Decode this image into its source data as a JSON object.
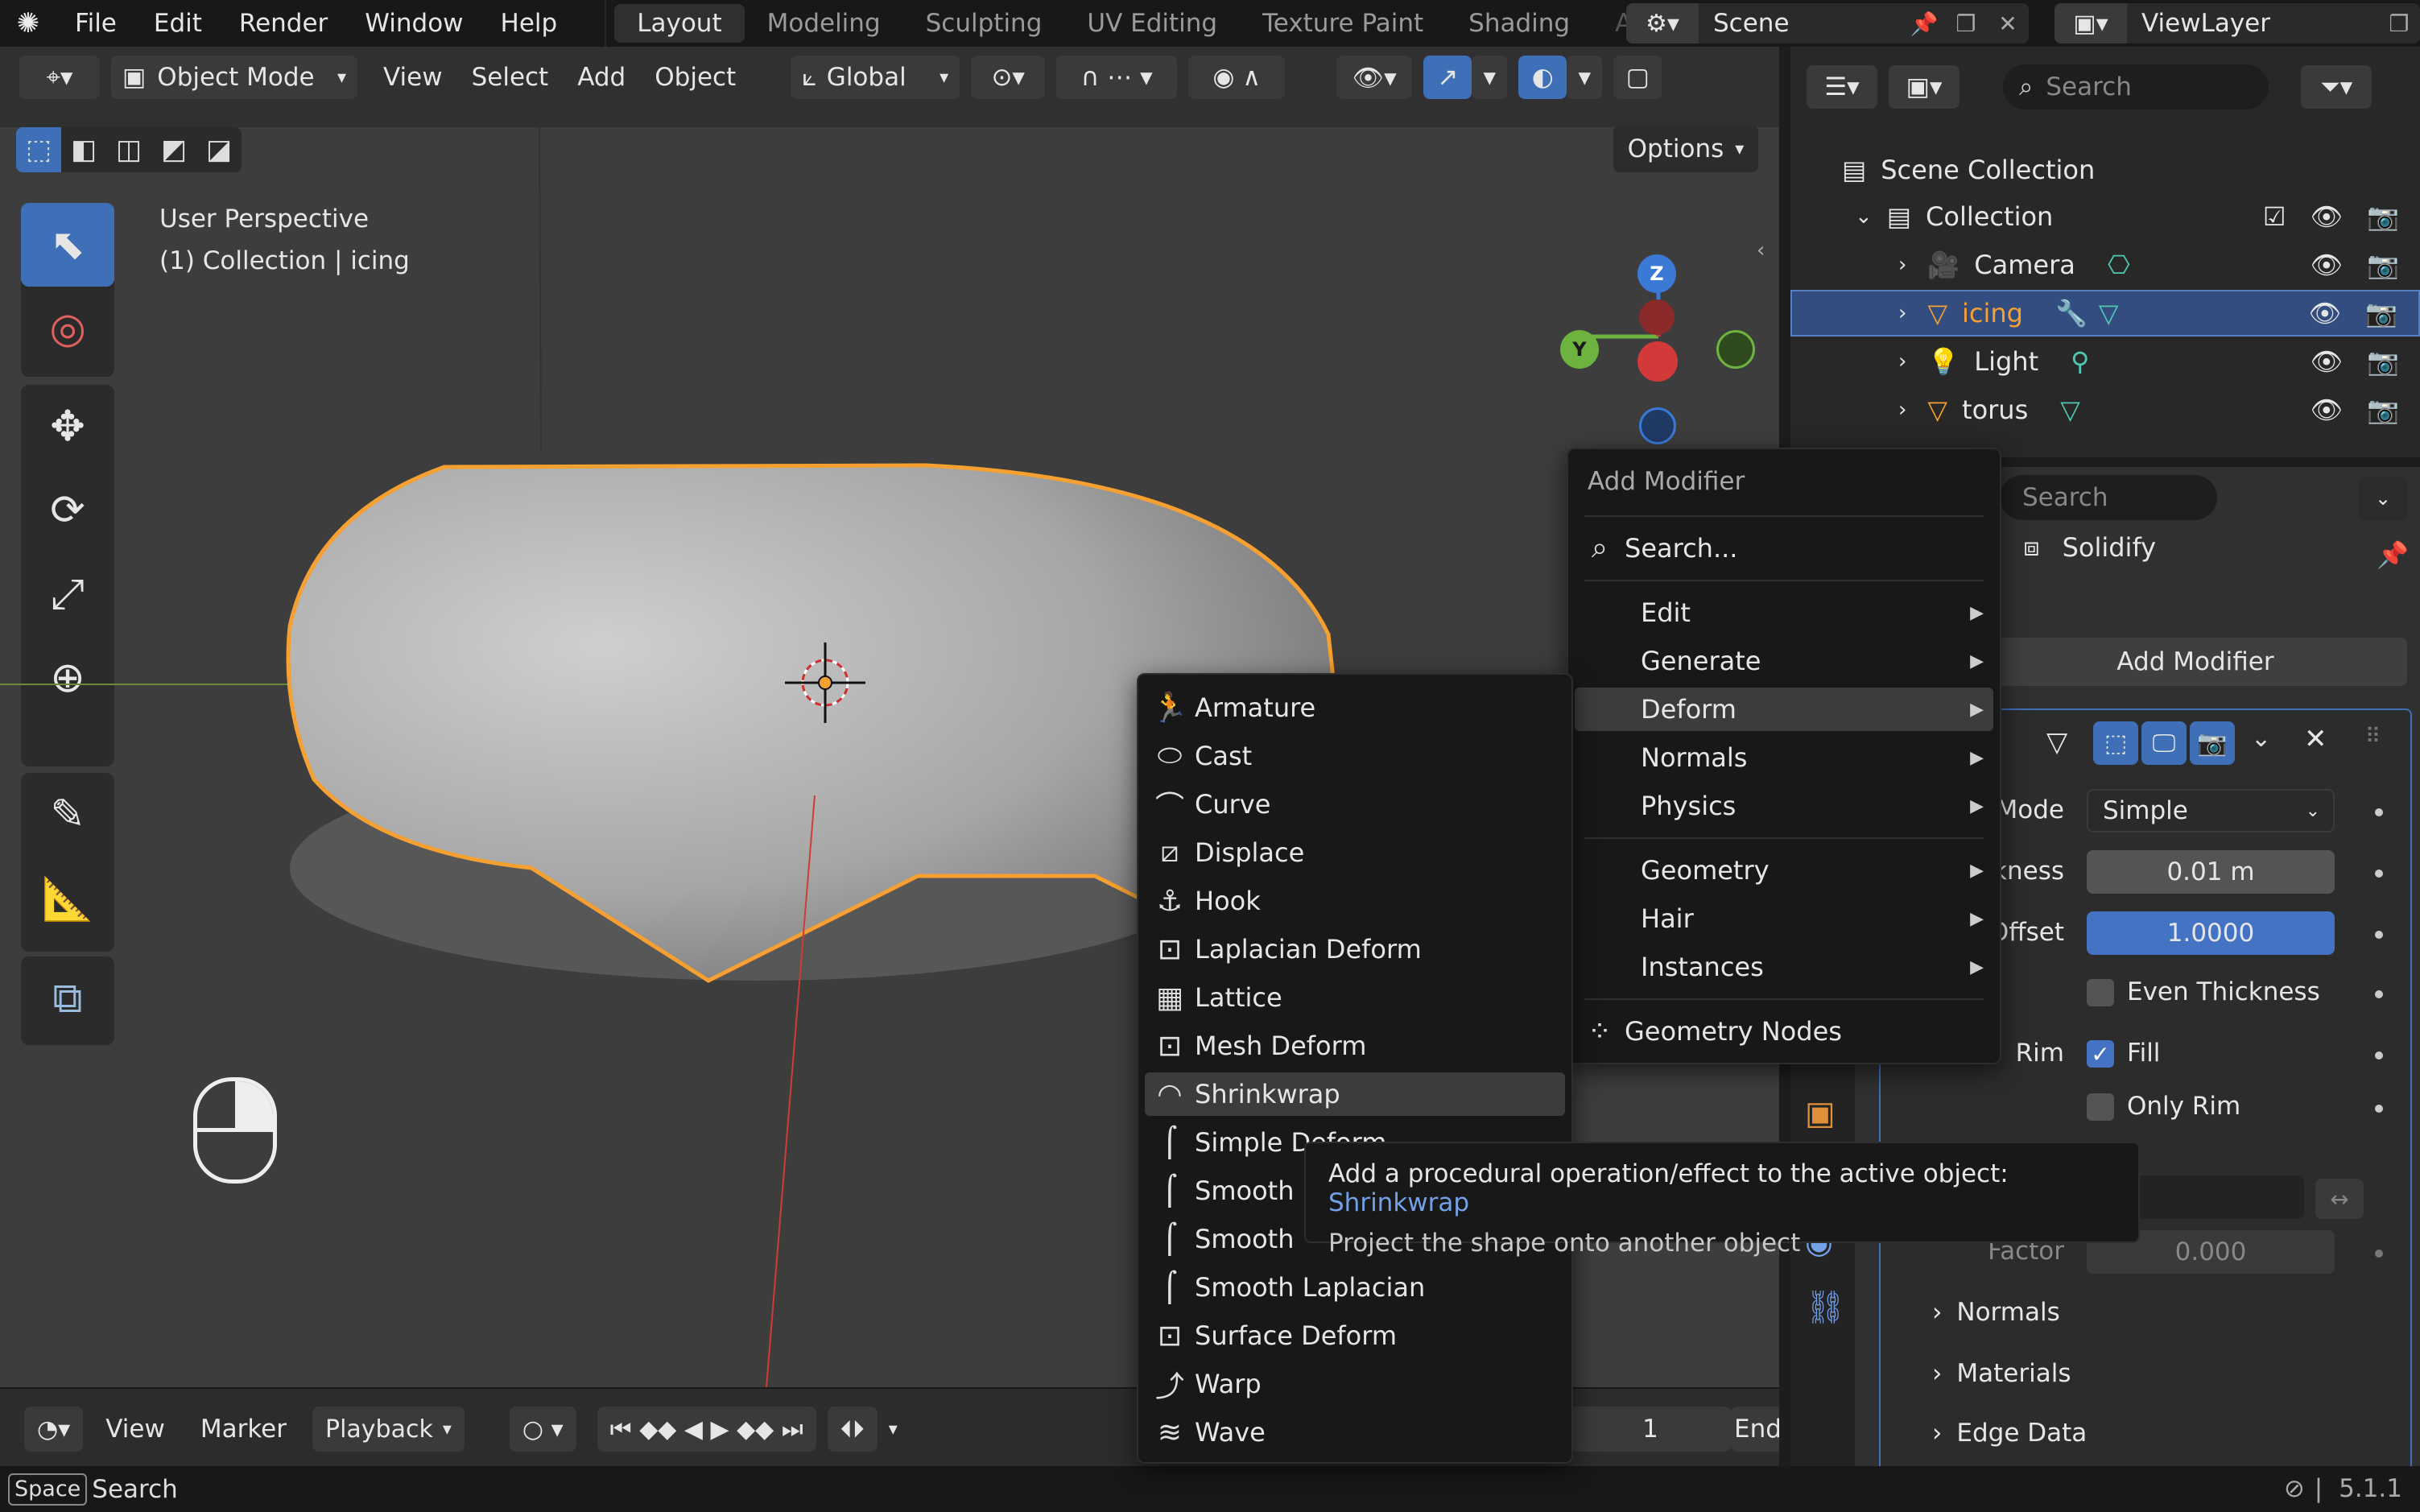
{
  "topbar": {
    "menus": [
      "File",
      "Edit",
      "Render",
      "Window",
      "Help"
    ],
    "workspaces": [
      "Layout",
      "Modeling",
      "Sculpting",
      "UV Editing",
      "Texture Paint",
      "Shading",
      "An"
    ],
    "active_workspace": "Layout",
    "scene": "Scene",
    "view_layer": "ViewLayer"
  },
  "viewport": {
    "mode": "Object Mode",
    "menus": [
      "View",
      "Select",
      "Add",
      "Object"
    ],
    "orientation": "Global",
    "options_label": "Options",
    "info_line1": "User Perspective",
    "info_line2": "(1) Collection | icing",
    "gizmo": {
      "z": "Z",
      "y": "Y"
    }
  },
  "timeline": {
    "menus": [
      "View",
      "Marker"
    ],
    "playback": "Playback",
    "frame_current": "1",
    "end_label": "End"
  },
  "statusbar": {
    "key": "Space",
    "action": "Search",
    "version": "5.1.1"
  },
  "outliner": {
    "search_placeholder": "Search",
    "scene_collection": "Scene Collection",
    "collection": "Collection",
    "items": [
      {
        "name": "Camera"
      },
      {
        "name": "icing"
      },
      {
        "name": "Light"
      },
      {
        "name": "torus"
      }
    ]
  },
  "properties": {
    "search_placeholder": "Search",
    "first_modifier": "Solidify",
    "add_modifier": "Add Modifier",
    "mode_label": "Mode",
    "mode_value": "Simple",
    "thickness_label": "kness",
    "thickness_value": "0.01 m",
    "offset_label": "Offset",
    "offset_value": "1.0000",
    "even_thickness": "Even Thickness",
    "rim_label": "Rim",
    "fill_label": "Fill",
    "only_rim": "Only Rim",
    "factor_label": "Factor",
    "factor_value": "0.000",
    "sections": [
      "Normals",
      "Materials",
      "Edge Data"
    ]
  },
  "add_modifier_menu": {
    "title": "Add Modifier",
    "search": "Search...",
    "groups1": [
      "Edit",
      "Generate",
      "Deform",
      "Normals",
      "Physics"
    ],
    "groups2": [
      "Geometry",
      "Hair",
      "Instances"
    ],
    "geometry_nodes": "Geometry Nodes",
    "highlighted": "Deform"
  },
  "deform_menu": {
    "items": [
      "Armature",
      "Cast",
      "Curve",
      "Displace",
      "Hook",
      "Laplacian Deform",
      "Lattice",
      "Mesh Deform",
      "Shrinkwrap",
      "Simple Deform",
      "Smooth",
      "Smooth",
      "Smooth Laplacian",
      "Surface Deform",
      "Warp",
      "Wave"
    ],
    "highlighted": "Shrinkwrap"
  },
  "tooltip": {
    "line1_prefix": "Add a procedural operation/effect to the active object: ",
    "line1_accent": "Shrinkwrap",
    "line2": "Project the shape onto another object"
  },
  "colors": {
    "accent_blue": "#4573c4",
    "selection_orange": "#f5a030",
    "header": "#303030",
    "viewport": "#3d3d3d"
  }
}
